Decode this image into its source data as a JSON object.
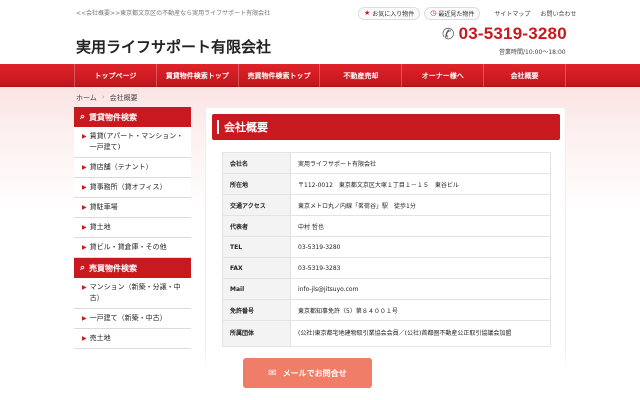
{
  "header": {
    "tagline": "<<会社概要>>東京都文京区の不動産なら実用ライフサポート有限会社",
    "company_name": "実用ライフサポート有限会社",
    "favorites_label": "お気に入り物件",
    "recent_label": "最近見た物件",
    "sitemap_label": "サイトマップ",
    "contact_label": "お問い合わせ",
    "phone": "03-5319-3280",
    "hours": "営業時間/10:00～18:00"
  },
  "nav": {
    "items": [
      "トップページ",
      "賃貸物件検索トップ",
      "売買物件検索トップ",
      "不動産売却",
      "オーナー様へ",
      "会社概要"
    ]
  },
  "breadcrumb": {
    "home": "ホーム",
    "current": "会社概要"
  },
  "sidebar": {
    "rental_head": "賃貸物件検索",
    "rental_items": [
      "賃貸(アパート・マンション・一戸建て)",
      "貸店舗（テナント）",
      "貸事務所（貸オフィス）",
      "貸駐車場",
      "貸土地",
      "貸ビル・貸倉庫・その他"
    ],
    "sale_head": "売買物件検索",
    "sale_items": [
      "マンション（新築・分譲・中古）",
      "一戸建て（新築・中古）",
      "売土地"
    ]
  },
  "main": {
    "title": "会社概要",
    "rows": [
      {
        "k": "会社名",
        "v": "実用ライフサポート有限会社"
      },
      {
        "k": "所在地",
        "v": "〒112-0012　東京都文京区大塚１丁目１－１５　東谷ビル"
      },
      {
        "k": "交通アクセス",
        "v": "東京メトロ丸ノ内線「茗荷谷」駅　徒歩1分"
      },
      {
        "k": "代表者",
        "v": "中村 哲也"
      },
      {
        "k": "TEL",
        "v": "03-5319-3280"
      },
      {
        "k": "FAX",
        "v": "03-5319-3283"
      },
      {
        "k": "Mail",
        "v": "info-jls@jitsuyo.com"
      },
      {
        "k": "免許番号",
        "v": "東京都知事免許（5）第８４００１号"
      },
      {
        "k": "所属団体",
        "v": "(公社)東京都宅地建物取引業協会会員／(公社)首都圏不動産公正取引協議会加盟"
      }
    ]
  },
  "mail_button": {
    "label": "メールでお問合せ"
  },
  "colors": {
    "brand_red": "#c8191e",
    "mail_button": "#ef7d67"
  },
  "icons": {
    "favorites": "star-icon",
    "recent": "clock-icon",
    "phone": "phone-icon",
    "search": "search-icon",
    "mail": "envelope-icon"
  }
}
